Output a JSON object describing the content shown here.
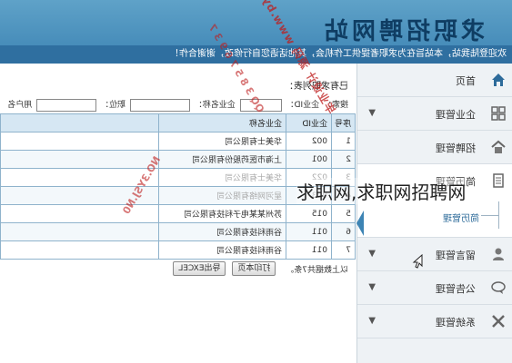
{
  "header": {
    "site_title": "求职招聘网站",
    "notice": "欢迎登陆我站，本站旨在为求职者提供工作机会，其他话语您自行修改，谢谢合作！"
  },
  "sidebar": {
    "items": [
      {
        "label": "首页",
        "icon": "home-icon"
      },
      {
        "label": "企业管理",
        "icon": "grid-icon",
        "caret": "▼"
      },
      {
        "label": "招聘管理",
        "icon": "house-icon"
      },
      {
        "label": "简历管理",
        "icon": "document-icon"
      },
      {
        "label": "留言管理",
        "icon": "user-icon",
        "caret": "▼"
      },
      {
        "label": "公告管理",
        "icon": "chat-icon",
        "caret": "▼"
      },
      {
        "label": "系统管理",
        "icon": "tools-icon",
        "caret": "▼"
      }
    ],
    "sub_item": "简历管理"
  },
  "content": {
    "heading": "已有求职列表：",
    "search": {
      "label": "搜索：",
      "company_id_label": "企业ID：",
      "company_name_label": "企业名称：",
      "position_label": "职位：",
      "username_label": "用户名"
    },
    "table": {
      "headers": [
        "序号",
        "企业ID",
        "企业名称"
      ],
      "rows": [
        [
          "1",
          "002",
          "华美士有限公司"
        ],
        [
          "2",
          "001",
          "上海市医药股份有限公司"
        ],
        [
          "3",
          "022",
          "华美士有限公司"
        ],
        [
          "4",
          "003",
          "星河网络有限公司"
        ],
        [
          "5",
          "015",
          "苏州某某电子科技有限公司"
        ],
        [
          "6",
          "011",
          "谷雨科技有限公司"
        ],
        [
          "7",
          "011",
          "谷雨科技有限公司"
        ]
      ]
    },
    "record_count": "以上数据共7条。",
    "buttons": {
      "print": "打印本页",
      "export": "导出EXCEL"
    }
  },
  "overlays": {
    "watermark_line1": "毕业设计 源码 www.bysj.com",
    "watermark_line2": "QQ 3 8 5 7 6 9 3 7",
    "watermark_line3": "NO.3YSJ.N0",
    "caption": "求职网,求职网招聘网"
  },
  "colors": {
    "header_gradient_top": "#5fa2c8",
    "header_gradient_bottom": "#3d84b4",
    "notice_bar": "#2f6fa0",
    "table_header": "#d6e7f3",
    "table_border": "#8fb3cc",
    "watermark": "#be1e1e"
  }
}
